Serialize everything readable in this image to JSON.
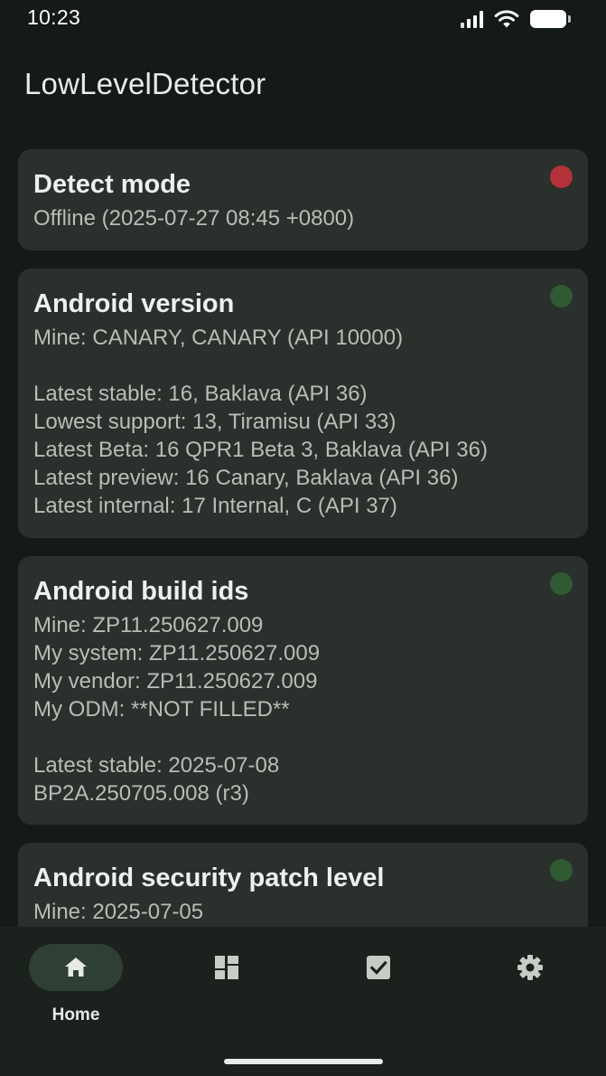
{
  "status_bar": {
    "time": "10:23",
    "icons": [
      "signal-icon",
      "wifi-icon",
      "battery-icon"
    ]
  },
  "app": {
    "title": "LowLevelDetector"
  },
  "colors": {
    "background": "#141a17",
    "card": "#2a302c",
    "status_red": "#b3323a",
    "status_green": "#2f5a32",
    "nav_active_pill": "#2f3f35"
  },
  "cards": [
    {
      "title": "Detect mode",
      "status": "red",
      "lines": [
        "Offline (2025-07-27 08:45 +0800)"
      ]
    },
    {
      "title": "Android version",
      "status": "green",
      "lines": [
        "Mine: CANARY, CANARY (API 10000)",
        "",
        "Latest stable: 16, Baklava (API 36)",
        "Lowest support: 13, Tiramisu (API 33)",
        "Latest Beta: 16 QPR1 Beta 3, Baklava (API 36)",
        "Latest preview: 16 Canary, Baklava (API 36)",
        "Latest internal: 17 Internal, C (API 37)"
      ]
    },
    {
      "title": "Android build ids",
      "status": "green",
      "lines": [
        "Mine: ZP11.250627.009",
        "My system: ZP11.250627.009",
        "My vendor: ZP11.250627.009",
        "My ODM: **NOT FILLED**",
        "",
        "Latest stable: 2025-07-08",
        "BP2A.250705.008 (r3)"
      ]
    },
    {
      "title": "Android security patch level",
      "status": "green",
      "lines": [
        "Mine: 2025-07-05"
      ]
    }
  ],
  "bottom_nav": {
    "items": [
      {
        "icon": "home-icon",
        "label": "Home",
        "active": true
      },
      {
        "icon": "dashboard-icon",
        "label": "",
        "active": false
      },
      {
        "icon": "checkbox-icon",
        "label": "",
        "active": false
      },
      {
        "icon": "gear-icon",
        "label": "",
        "active": false
      }
    ]
  }
}
